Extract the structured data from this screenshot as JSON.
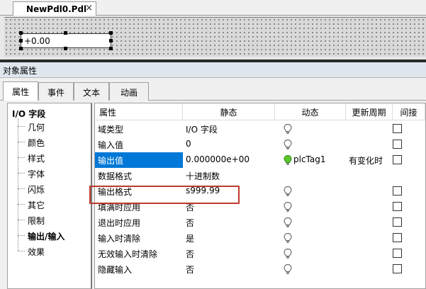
{
  "document_tab": {
    "title": "NewPdl0.Pdl",
    "close": "×"
  },
  "canvas": {
    "io_field_value": "+0.00"
  },
  "panel": {
    "title": "对象属性"
  },
  "tabs": [
    "属性",
    "事件",
    "文本",
    "动画"
  ],
  "tree": {
    "root": "I/O 字段",
    "items": [
      "几何",
      "颜色",
      "样式",
      "字体",
      "闪烁",
      "其它",
      "限制",
      "输出/输入",
      "效果"
    ],
    "selected_item": "输出/输入"
  },
  "grid": {
    "headers": {
      "name": "属性",
      "static": "静态",
      "dynamic": "动态",
      "cycle": "更新周期",
      "indirect": "间接"
    },
    "rows": [
      {
        "name": "域类型",
        "static": "I/O 字段",
        "bulb": "off",
        "dynamic": "",
        "cycle": "",
        "checkbox": true
      },
      {
        "name": "输入值",
        "static": "0",
        "bulb": "off",
        "dynamic": "",
        "cycle": "",
        "checkbox": true
      },
      {
        "name": "输出值",
        "static": "0.000000e+00",
        "bulb": "on",
        "dynamic": "plcTag1",
        "cycle": "有变化时",
        "checkbox": true
      },
      {
        "name": "数据格式",
        "static": "十进制数",
        "bulb": "none",
        "dynamic": "",
        "cycle": "",
        "checkbox": false
      },
      {
        "name": "输出格式",
        "static": "s999.99",
        "bulb": "off",
        "dynamic": "",
        "cycle": "",
        "checkbox": true
      },
      {
        "name": "填满时应用",
        "static": "否",
        "bulb": "off",
        "dynamic": "",
        "cycle": "",
        "checkbox": true
      },
      {
        "name": "退出时应用",
        "static": "否",
        "bulb": "off",
        "dynamic": "",
        "cycle": "",
        "checkbox": true
      },
      {
        "name": "输入时清除",
        "static": "是",
        "bulb": "off",
        "dynamic": "",
        "cycle": "",
        "checkbox": true
      },
      {
        "name": "无效输入时清除",
        "static": "否",
        "bulb": "off",
        "dynamic": "",
        "cycle": "",
        "checkbox": true
      },
      {
        "name": "隐藏输入",
        "static": "否",
        "bulb": "off",
        "dynamic": "",
        "cycle": "",
        "checkbox": true
      }
    ],
    "selected_row": "输出值",
    "highlighted_row": "输出格式"
  },
  "colors": {
    "selection": "#0078d7",
    "highlight_box": "#c0392b",
    "bulb_on": "#5cc72a"
  }
}
